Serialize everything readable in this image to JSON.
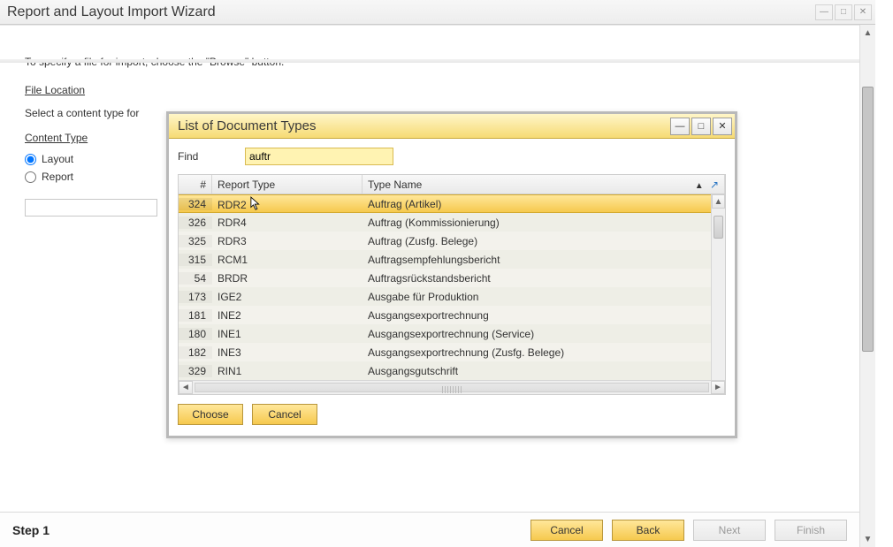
{
  "wizard": {
    "title": "Report and Layout Import Wizard",
    "instruction": "To specify a file for import, choose the \"Browse\" button.",
    "fileLocationLabel": "File Location",
    "selectContentLabel": "Select a content type for",
    "contentTypeHeading": "Content Type",
    "radios": {
      "layout": "Layout",
      "report": "Report"
    },
    "footer": {
      "step": "Step 1",
      "cancel": "Cancel",
      "back": "Back",
      "next": "Next",
      "finish": "Finish"
    }
  },
  "modal": {
    "title": "List of Document Types",
    "findLabel": "Find",
    "findValue": "auftr",
    "columns": {
      "num": "#",
      "reportType": "Report Type",
      "typeName": "Type Name"
    },
    "rows": [
      {
        "num": "324",
        "rt": "RDR2",
        "tn": "Auftrag (Artikel)",
        "selected": true
      },
      {
        "num": "326",
        "rt": "RDR4",
        "tn": "Auftrag (Kommissionierung)"
      },
      {
        "num": "325",
        "rt": "RDR3",
        "tn": "Auftrag (Zusfg. Belege)"
      },
      {
        "num": "315",
        "rt": "RCM1",
        "tn": "Auftragsempfehlungsbericht"
      },
      {
        "num": "54",
        "rt": "BRDR",
        "tn": "Auftragsrückstandsbericht"
      },
      {
        "num": "173",
        "rt": "IGE2",
        "tn": "Ausgabe für Produktion"
      },
      {
        "num": "181",
        "rt": "INE2",
        "tn": "Ausgangsexportrechnung"
      },
      {
        "num": "180",
        "rt": "INE1",
        "tn": "Ausgangsexportrechnung (Service)"
      },
      {
        "num": "182",
        "rt": "INE3",
        "tn": "Ausgangsexportrechnung (Zusfg. Belege)"
      },
      {
        "num": "329",
        "rt": "RIN1",
        "tn": "Ausgangsgutschrift"
      }
    ],
    "actions": {
      "choose": "Choose",
      "cancel": "Cancel"
    }
  }
}
